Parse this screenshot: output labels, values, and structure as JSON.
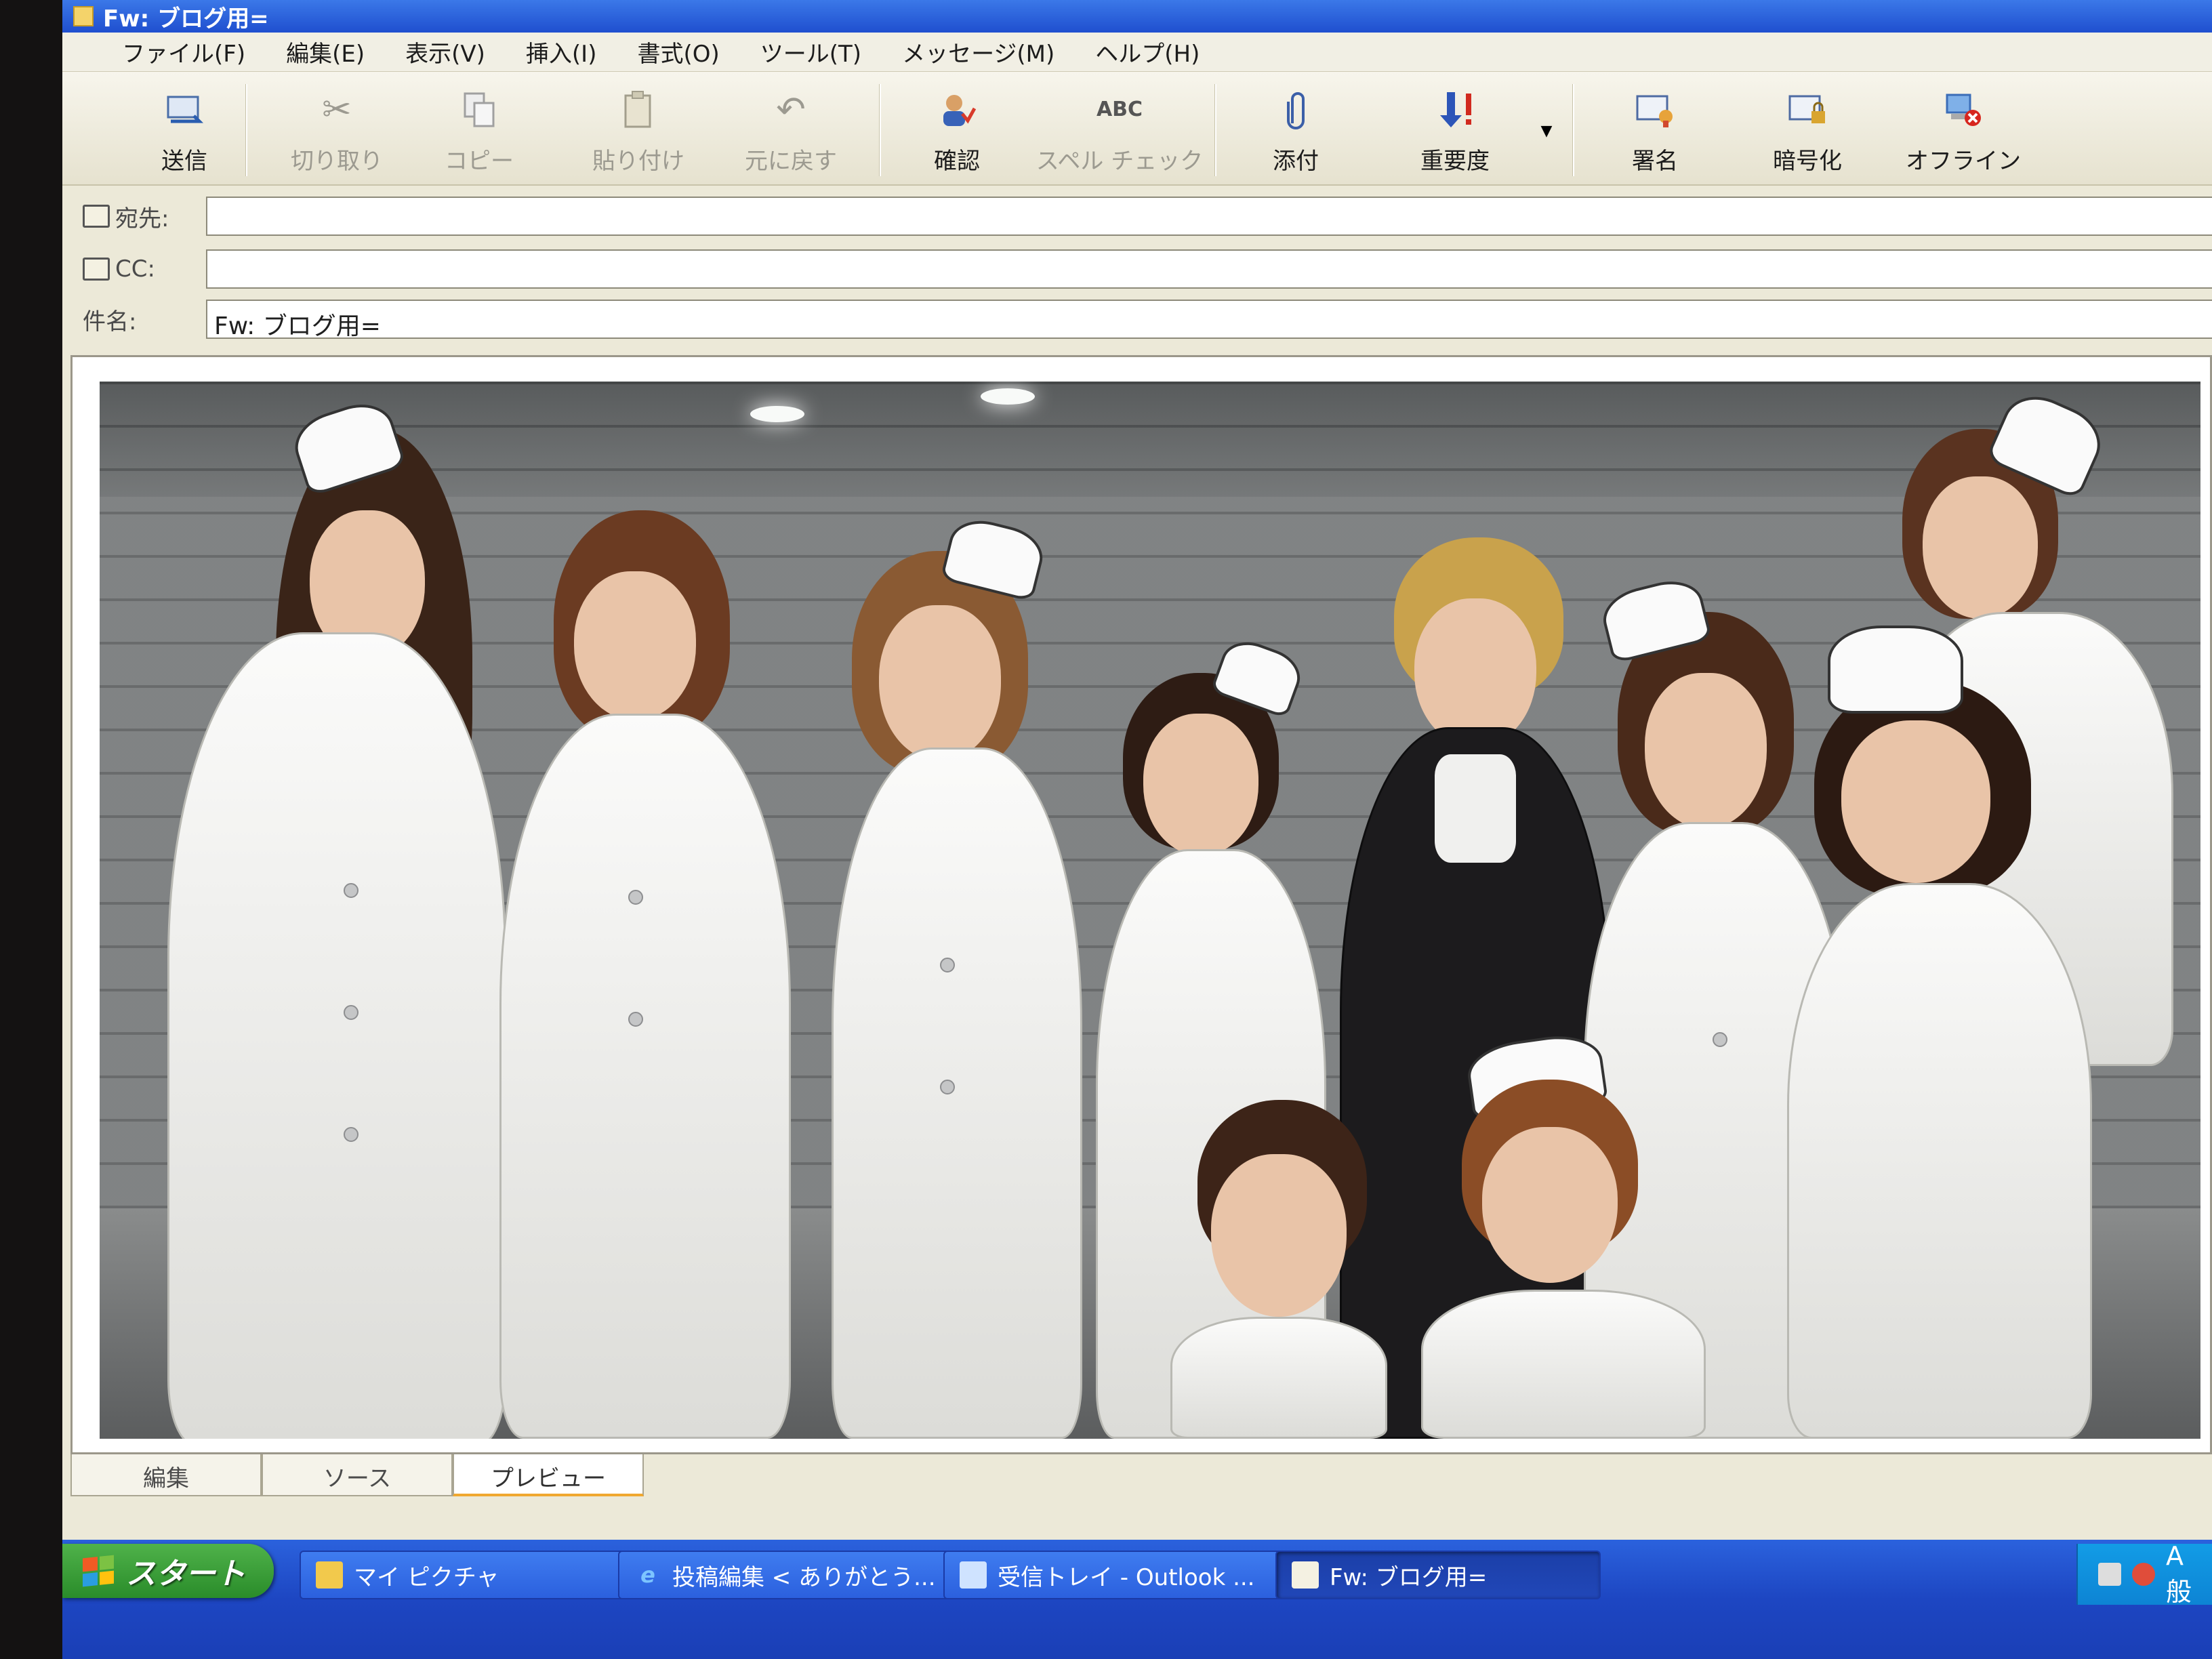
{
  "window": {
    "title": "Fw: ブログ用="
  },
  "menu": [
    "ファイル(F)",
    "編集(E)",
    "表示(V)",
    "挿入(I)",
    "書式(O)",
    "ツール(T)",
    "メッセージ(M)",
    "ヘルプ(H)"
  ],
  "toolbar": {
    "send": "送信",
    "cut": "切り取り",
    "copy": "コピー",
    "paste": "貼り付け",
    "undo": "元に戻す",
    "check": "確認",
    "spellcheck": "スペル チェック",
    "attach": "添付",
    "priority": "重要度",
    "sign": "署名",
    "encrypt": "暗号化",
    "offline": "オフライン",
    "spellcheck_icon_text": "ABC"
  },
  "envelope": {
    "to_label": "宛先:",
    "to_value": "",
    "cc_label": "CC:",
    "cc_value": "",
    "subject_label": "件名:",
    "subject_value": "Fw: ブログ用="
  },
  "view_tabs": [
    "編集",
    "ソース",
    "プレビュー"
  ],
  "active_view_tab": "プレビュー",
  "taskbar": {
    "start": "スタート",
    "items": [
      {
        "label": "マイ ピクチャ",
        "icon": "folder-icon"
      },
      {
        "label": "投稿編集 < ありがとう...",
        "icon": "ie-icon"
      },
      {
        "label": "受信トレイ - Outlook ...",
        "icon": "outlook-icon"
      },
      {
        "label": "Fw: ブログ用=",
        "icon": "compose-icon"
      }
    ],
    "tray_ime": "A 般"
  },
  "colors": {
    "taskbar": "#2b62dd",
    "start": "#3fa43c",
    "window_bg": "#ece9d8"
  }
}
